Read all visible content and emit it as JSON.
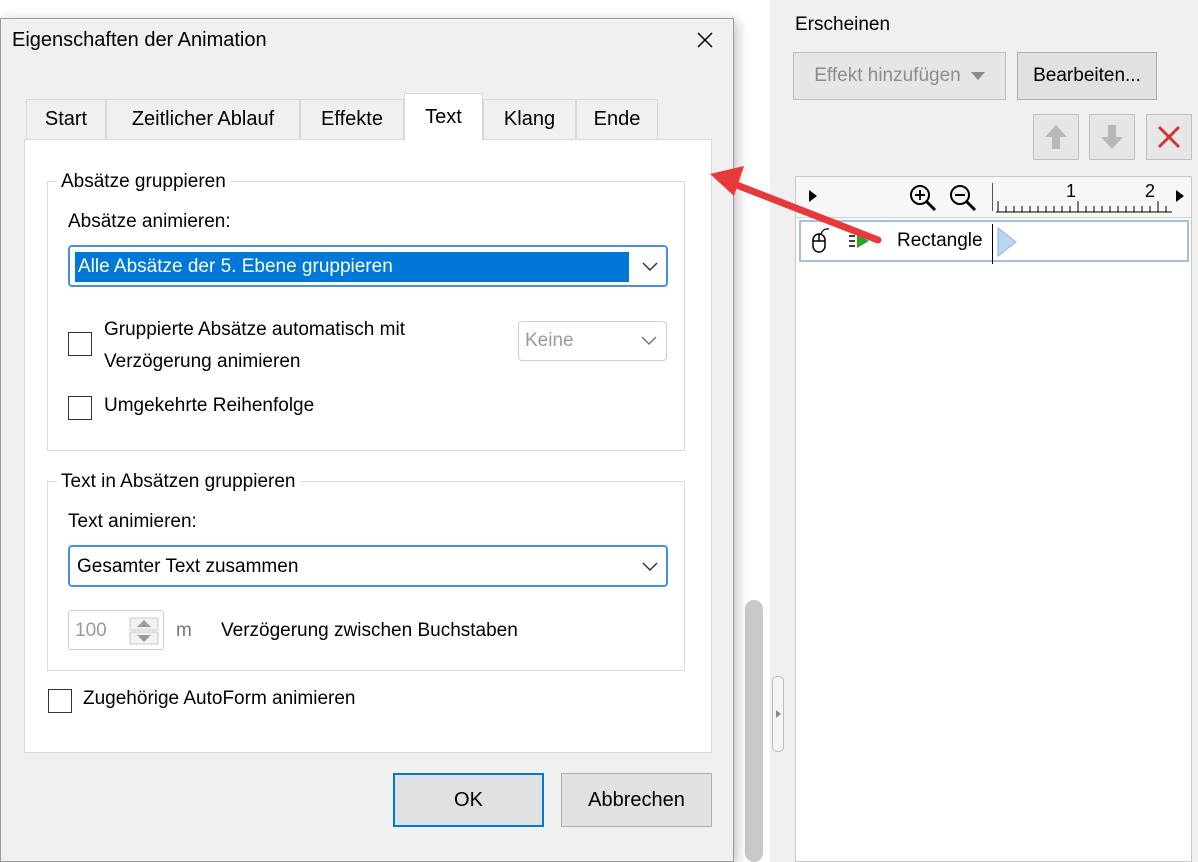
{
  "dialog": {
    "title": "Eigenschaften der Animation",
    "tabs": [
      {
        "label": "Start"
      },
      {
        "label": "Zeitlicher Ablauf"
      },
      {
        "label": "Effekte"
      },
      {
        "label": "Text"
      },
      {
        "label": "Klang"
      },
      {
        "label": "Ende"
      }
    ],
    "active_tab": "Text",
    "group_paragraphs": {
      "legend": "Absätze gruppieren",
      "animate_label": "Absätze animieren:",
      "animate_value": "Alle Absätze der 5. Ebene gruppieren",
      "auto_delay_label_line1": "Gruppierte Absätze automatisch mit",
      "auto_delay_label_line2": "Verzögerung animieren",
      "auto_delay_value": "Keine",
      "reverse_label": "Umgekehrte Reihenfolge"
    },
    "group_text": {
      "legend": "Text in Absätzen gruppieren",
      "animate_label": "Text animieren:",
      "animate_value": "Gesamter Text zusammen",
      "delay_value": "100",
      "delay_unit": "m",
      "delay_label": "Verzögerung zwischen Buchstaben"
    },
    "animate_shape_label": "Zugehörige AutoForm animieren",
    "ok_label": "OK",
    "cancel_label": "Abbrechen"
  },
  "panel": {
    "title": "Erscheinen",
    "add_effect_label": "Effekt hinzufügen",
    "edit_label": "Bearbeiten...",
    "timeline_ticks": [
      "1",
      "2"
    ],
    "animation_item": "Rectangle"
  },
  "colors": {
    "accent": "#0078d7",
    "arrow": "#e8393a",
    "delete": "#d13438"
  }
}
